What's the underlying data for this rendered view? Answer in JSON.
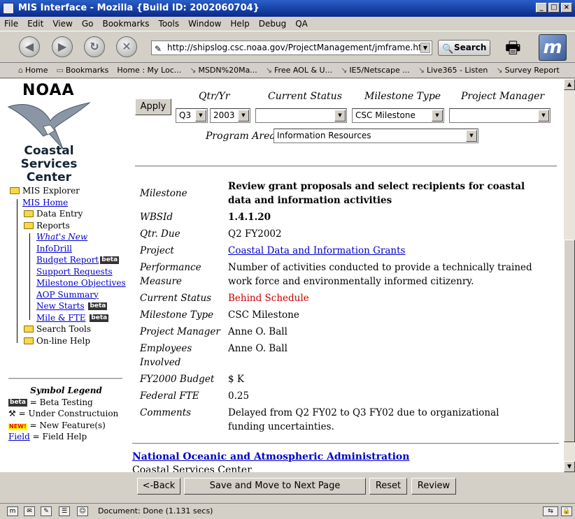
{
  "window": {
    "title": "MIS Interface - Mozilla {Build ID: 2002060704}"
  },
  "menu": [
    "File",
    "Edit",
    "View",
    "Go",
    "Bookmarks",
    "Tools",
    "Window",
    "Help",
    "Debug",
    "QA"
  ],
  "nav": {
    "url": "http://shipslog.csc.noaa.gov/ProjectManagement/jmframe.htm",
    "search_label": "Search"
  },
  "bookmarks": [
    "Home",
    "Bookmarks",
    "Home : My Loc...",
    "MSDN%20Ma...",
    "Free AOL & U...",
    "IE5/Netscape ...",
    "Live365 - Listen",
    "Survey Report"
  ],
  "sidebar": {
    "logo_text": "NOAA",
    "center_name": [
      "Coastal",
      "Services",
      "Center"
    ],
    "tree": {
      "root": "MIS Explorer",
      "home": "MIS Home",
      "data_entry": "Data Entry",
      "reports": "Reports",
      "report_items": [
        "What's New",
        "InfoDrill",
        "Budget Report",
        "Support Requests",
        "Milestone Objectives",
        "AOP Summary",
        "New Starts",
        "Mile & FTE"
      ],
      "search_tools": "Search Tools",
      "online_help": "On-line Help"
    },
    "beta_label": "beta",
    "legend": {
      "title": "Symbol Legend",
      "beta": "= Beta Testing",
      "construction": "= Under Constructuion",
      "new_icon": "NEW!",
      "new": "= New Feature(s)",
      "field_link": "Field",
      "field": "= Field Help"
    }
  },
  "filters": {
    "apply_label": "Apply",
    "qtr_yr_label": "Qtr/Yr",
    "quarter": "Q3",
    "year": "2003",
    "current_status_label": "Current Status",
    "current_status": "",
    "milestone_type_label": "Milestone Type",
    "milestone_type": "CSC Milestone",
    "project_manager_label": "Project Manager",
    "project_manager": "",
    "program_area_label": "Program Area",
    "program_area": "Information Resources"
  },
  "details": {
    "milestone_label": "Milestone",
    "milestone": "Review grant proposals and select recipients for coastal data and information activities",
    "wbsid_label": "WBSId",
    "wbsid": "1.4.1.20",
    "qtr_due_label": "Qtr. Due",
    "qtr_due": "Q2  FY2002",
    "project_label": "Project",
    "project": "Coastal Data and Information Grants",
    "performance_label": "Performance Measure",
    "performance": "Number of activities conducted to provide a technically trained work force and environmentally informed citizenry.",
    "status_label": "Current Status",
    "status": "Behind Schedule",
    "milestone_type_label": "Milestone Type",
    "milestone_type": "CSC Milestone",
    "pm_label": "Project Manager",
    "pm": "Anne O. Ball",
    "employees_label": "Employees Involved",
    "employees": "Anne O. Ball",
    "budget_label": "FY2000 Budget",
    "budget": "$ K",
    "fte_label": "Federal FTE",
    "fte": "0.25",
    "comments_label": "Comments",
    "comments": "Delayed from Q2 FY02 to Q3 FY02 due to organizational funding uncertainties."
  },
  "footer_link": "National Oceanic and Atmospheric Administration",
  "footer_cut": "Coastal Services Center",
  "buttons": {
    "back": "<-Back",
    "save_next": "Save and Move to Next Page",
    "reset": "Reset",
    "review": "Review"
  },
  "status": {
    "text": "Document: Done (1.131 secs)"
  }
}
